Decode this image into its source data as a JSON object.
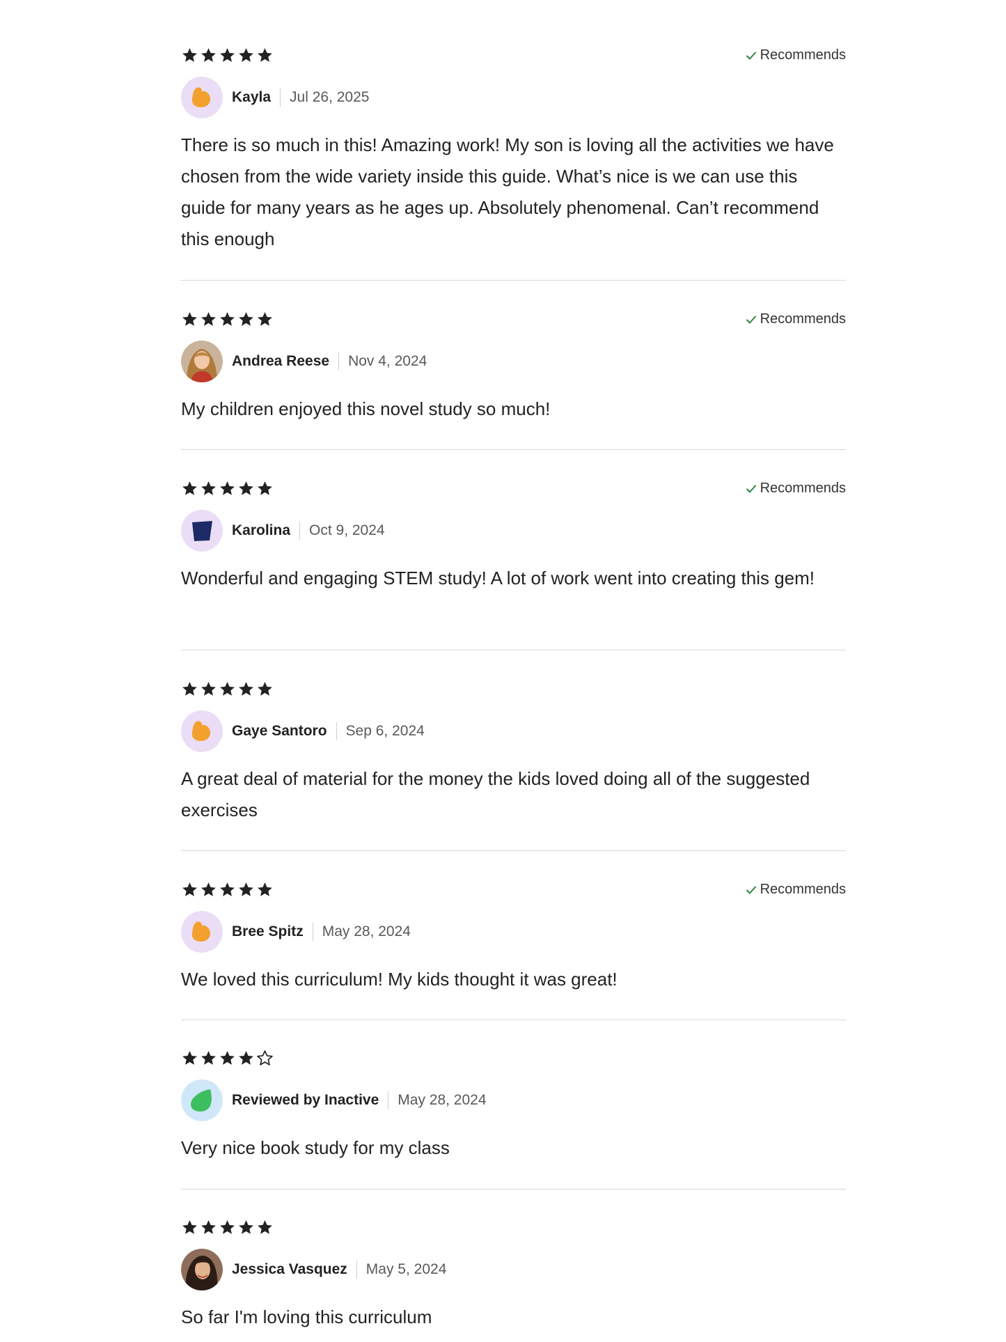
{
  "reviews": [
    {
      "rating": 5,
      "recommends": true,
      "recommends_label": "Recommends",
      "author": "Kayla",
      "date": "Jul 26, 2025",
      "avatar": {
        "icon": "orange-blob-avatar",
        "bg": "#ECDDF6",
        "fg": "#F2A12E"
      },
      "text": "There is so much in this! Amazing work! My son is loving all the activities we have chosen from the wide variety inside this guide. What’s nice is we can use this guide for many years as he ages up. Absolutely phenomenal. Can’t recommend this enough"
    },
    {
      "rating": 5,
      "recommends": true,
      "recommends_label": "Recommends",
      "author": "Andrea Reese",
      "date": "Nov 4, 2024",
      "avatar": {
        "icon": "user-photo-avatar"
      },
      "text": "My children enjoyed this novel study so much!"
    },
    {
      "rating": 5,
      "recommends": true,
      "recommends_label": "Recommends",
      "author": "Karolina",
      "date": "Oct 9, 2024",
      "avatar": {
        "icon": "navy-shape-avatar",
        "bg": "#ECDDF6",
        "fg": "#1C2A66"
      },
      "text": "Wonderful and engaging STEM study! A lot of work went into creating this gem!"
    },
    {
      "rating": 5,
      "recommends": false,
      "author": "Gaye Santoro",
      "date": "Sep 6, 2024",
      "avatar": {
        "icon": "orange-blob-avatar",
        "bg": "#ECDDF6",
        "fg": "#F2A12E"
      },
      "text": "A great deal of material for the money the kids loved doing all of the suggested exercises"
    },
    {
      "rating": 5,
      "recommends": true,
      "recommends_label": "Recommends",
      "author": "Bree Spitz",
      "date": "May 28, 2024",
      "avatar": {
        "icon": "orange-blob-avatar",
        "bg": "#ECDDF6",
        "fg": "#F2A12E"
      },
      "text": "We loved this curriculum! My kids thought it was great!"
    },
    {
      "rating": 4,
      "recommends": false,
      "author": "Reviewed by Inactive",
      "date": "May 28, 2024",
      "avatar": {
        "icon": "green-leaf-avatar",
        "bg": "#CFE7F8",
        "fg": "#3DBF5F"
      },
      "text": "Very nice book study for my class"
    },
    {
      "rating": 5,
      "recommends": false,
      "author": "Jessica Vasquez",
      "date": "May 5, 2024",
      "avatar": {
        "icon": "user-photo-avatar"
      },
      "text": "So far I'm loving this curriculum"
    }
  ],
  "colors": {
    "star": "#222222",
    "check": "#2E8540",
    "divider": "#D9D9D9"
  }
}
